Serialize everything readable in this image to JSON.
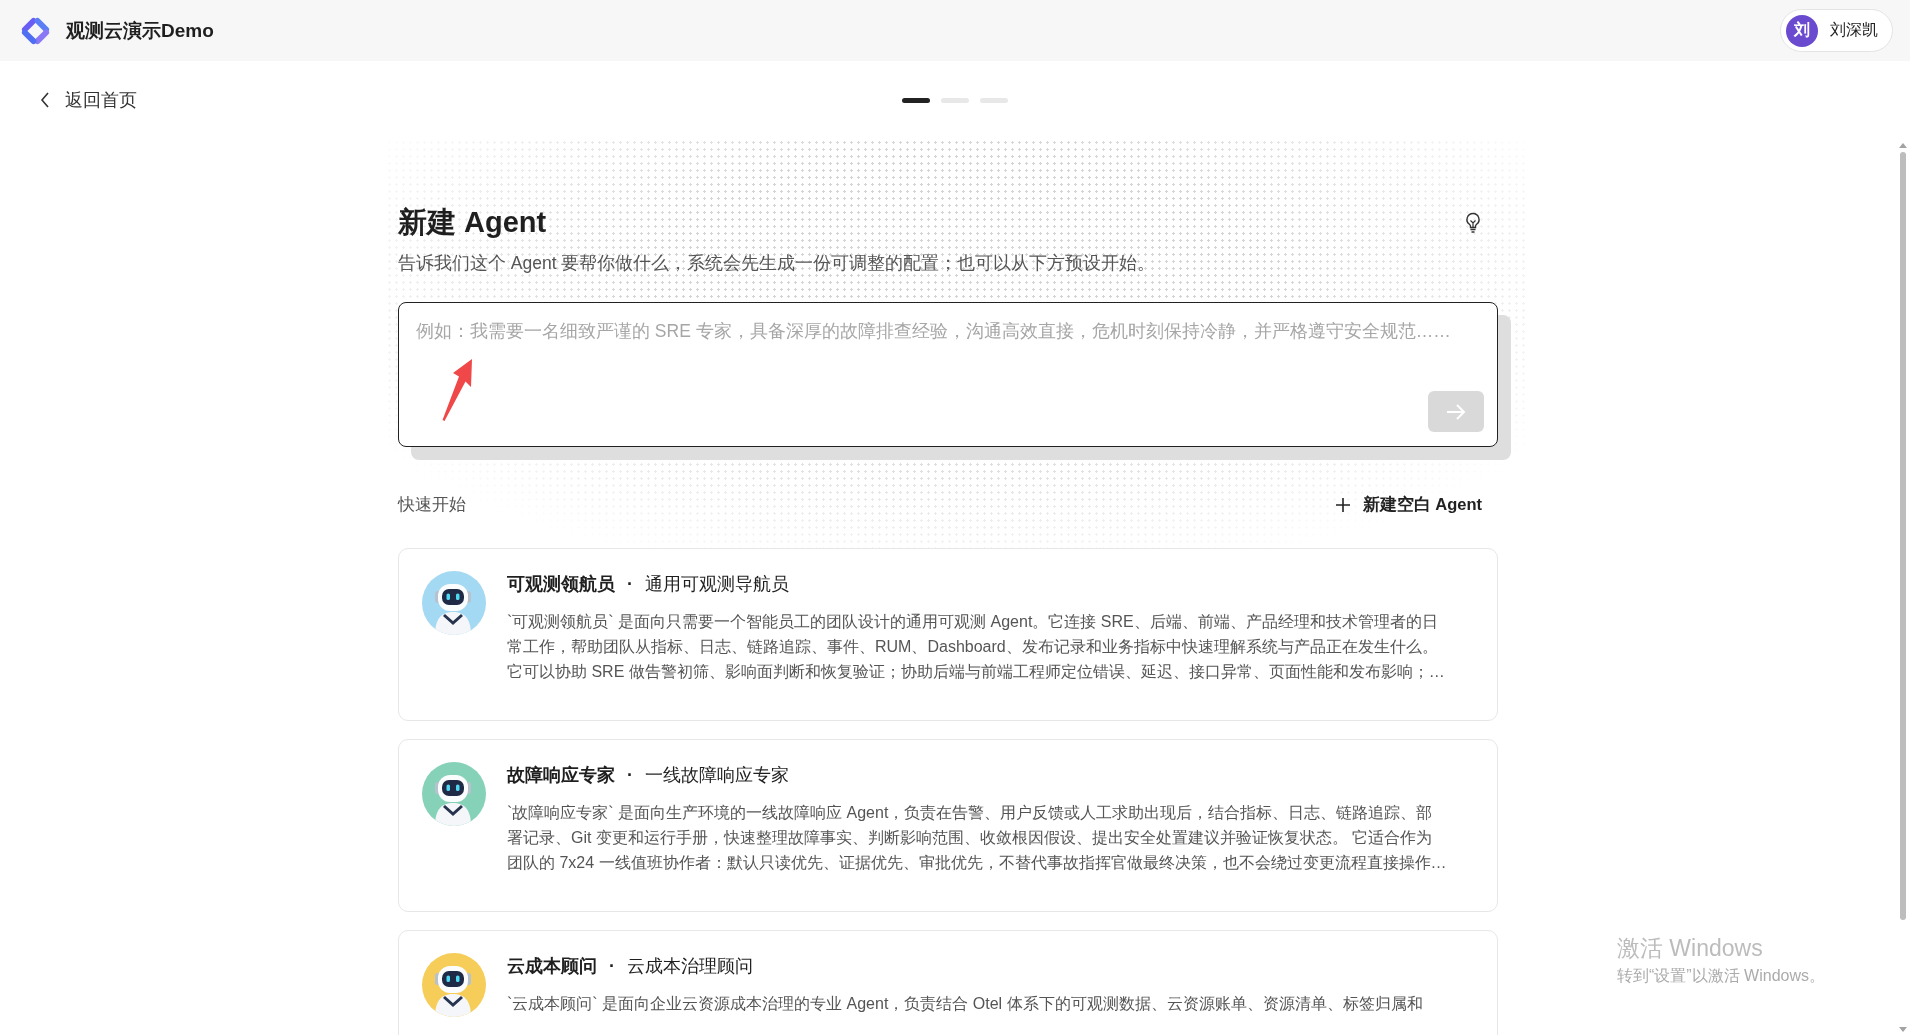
{
  "header": {
    "title": "观测云演示Demo",
    "user": {
      "avatar_text": "刘",
      "name": "刘深凯"
    }
  },
  "nav": {
    "back_label": "返回首页",
    "steps": [
      {
        "selected": true
      },
      {
        "selected": false
      },
      {
        "selected": false
      }
    ]
  },
  "composer": {
    "title": "新建 Agent",
    "subtitle": "告诉我们这个 Agent 要帮你做什么，系统会先生成一份可调整的配置；也可以从下方预设开始。",
    "input": {
      "placeholder": "例如：我需要一名细致严谨的 SRE 专家，具备深厚的故障排查经验，沟通高效直接，危机时刻保持冷静，并严格遵守安全规范……"
    },
    "send_button": {
      "disabled": true
    }
  },
  "quick_start": {
    "label": "快速开始",
    "new_blank_button": "新建空白 Agent",
    "agents": [
      {
        "name": "可观测领航员",
        "separator": "·",
        "role": "通用可观测导航员",
        "color": "#a3d9f3",
        "description_lines": [
          "`可观测领航员` 是面向只需要一个智能员工的团队设计的通用可观测 Agent。它连接 SRE、后端、前端、产品经理和技术管理者的日",
          "常工作，帮助团队从指标、日志、链路追踪、事件、RUM、Dashboard、发布记录和业务指标中快速理解系统与产品正在发生什么。",
          "它可以协助 SRE 做告警初筛、影响面判断和恢复验证；协助后端与前端工程师定位错误、延迟、接口异常、页面性能和发布影响；…"
        ]
      },
      {
        "name": "故障响应专家",
        "separator": "·",
        "role": "一线故障响应专家",
        "color": "#86d2b8",
        "description_lines": [
          "`故障响应专家` 是面向生产环境的一线故障响应 Agent，负责在告警、用户反馈或人工求助出现后，结合指标、日志、链路追踪、部",
          "署记录、Git 变更和运行手册，快速整理故障事实、判断影响范围、收敛根因假设、提出安全处置建议并验证恢复状态。 它适合作为",
          "团队的 7x24 一线值班协作者：默认只读优先、证据优先、审批优先，不替代事故指挥官做最终决策，也不会绕过变更流程直接操作…"
        ]
      },
      {
        "name": "云成本顾问",
        "separator": "·",
        "role": "云成本治理顾问",
        "color": "#f5cd58",
        "description_lines": [
          "`云成本顾问` 是面向企业云资源成本治理的专业 Agent，负责结合 Otel 体系下的可观测数据、云资源账单、资源清单、标签归属和"
        ]
      }
    ]
  },
  "windows_activation": {
    "title": "激活 Windows",
    "hint": "转到“设置”以激活 Windows。"
  }
}
